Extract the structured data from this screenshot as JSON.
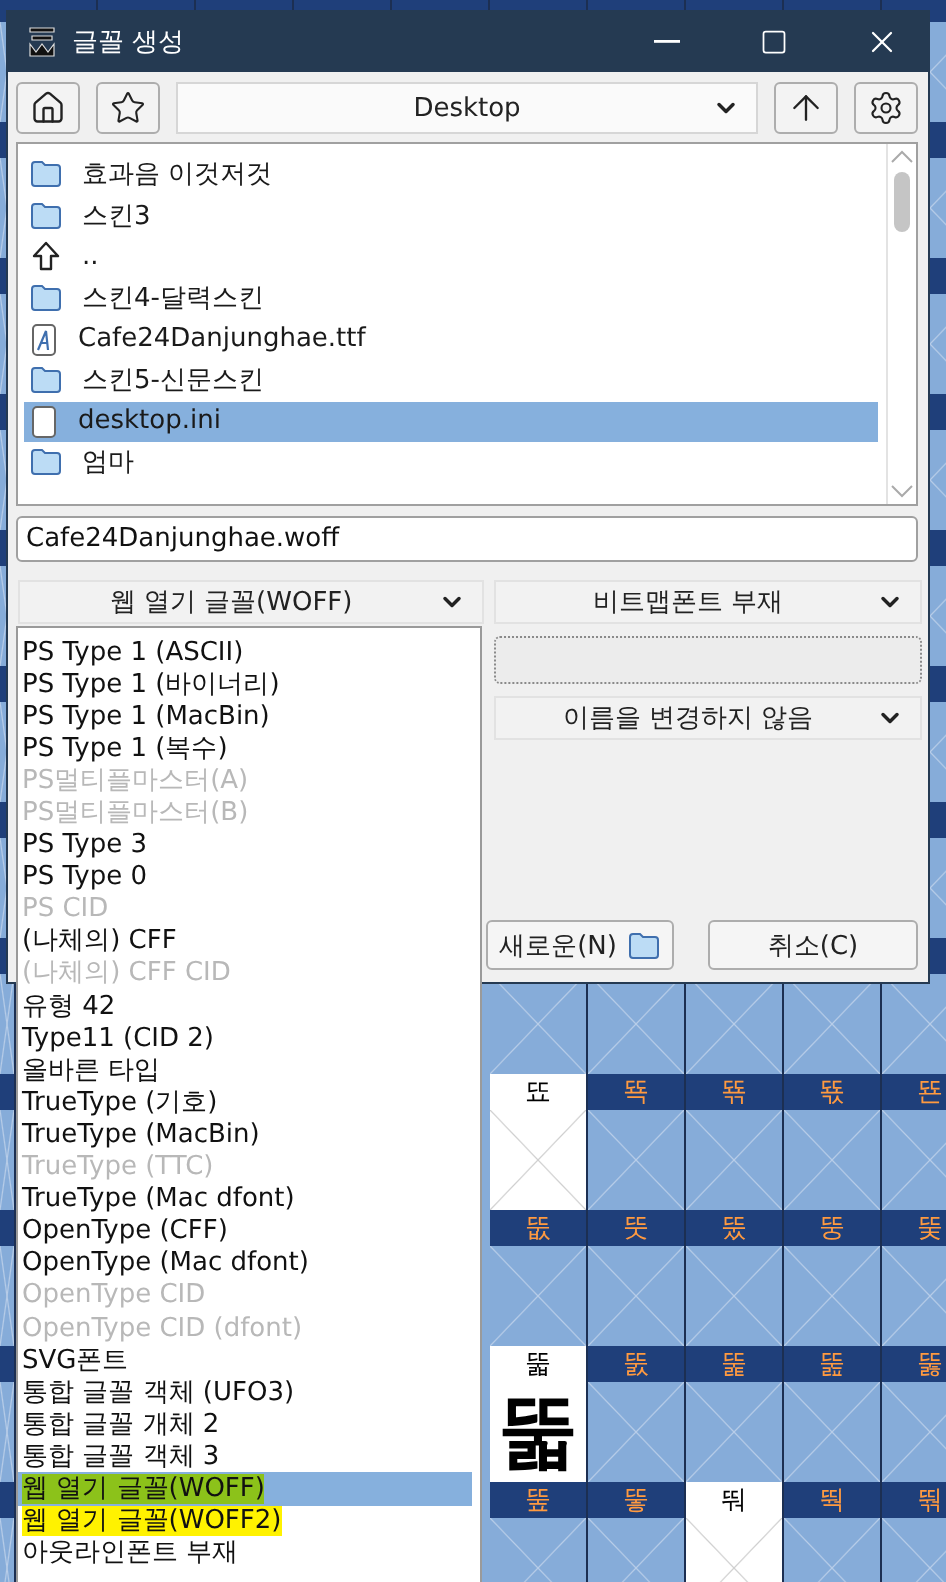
{
  "window": {
    "title": "글꼴 생성"
  },
  "toolbar": {
    "path": "Desktop"
  },
  "files": [
    {
      "name": "효과음 이것저것",
      "kind": "folder",
      "selected": false
    },
    {
      "name": "스킨3",
      "kind": "folder",
      "selected": false
    },
    {
      "name": "..",
      "kind": "parent",
      "selected": false
    },
    {
      "name": "스킨4-달력스킨",
      "kind": "folder",
      "selected": false
    },
    {
      "name": "Cafe24Danjunghae.ttf",
      "kind": "font",
      "selected": false
    },
    {
      "name": "스킨5-신문스킨",
      "kind": "folder",
      "selected": false
    },
    {
      "name": "desktop.ini",
      "kind": "file",
      "selected": true
    },
    {
      "name": "엄마",
      "kind": "folder",
      "selected": false
    }
  ],
  "filename": {
    "value": "Cafe24Danjunghae.woff"
  },
  "format_select": {
    "value": "웹 열기 글꼴(WOFF)"
  },
  "bitmap_select": {
    "value": "비트맵폰트 부재"
  },
  "rename_select": {
    "value": "이름을 변경하지 않음"
  },
  "buttons": [
    {
      "label": "새로운(N)",
      "kind": "new"
    },
    {
      "label": "취소(C)",
      "kind": "cancel"
    }
  ],
  "format_options": [
    {
      "label": "PS Type 1 (ASCII)",
      "disabled": false,
      "selected": false
    },
    {
      "label": "PS Type 1 (바이너리)",
      "disabled": false,
      "selected": false
    },
    {
      "label": "PS Type 1 (MacBin)",
      "disabled": false,
      "selected": false
    },
    {
      "label": "PS Type 1 (복수)",
      "disabled": false,
      "selected": false
    },
    {
      "label": "PS멀티플마스터(A)",
      "disabled": true,
      "selected": false
    },
    {
      "label": "PS멀티플마스터(B)",
      "disabled": true,
      "selected": false
    },
    {
      "label": "PS Type 3",
      "disabled": false,
      "selected": false
    },
    {
      "label": "PS Type 0",
      "disabled": false,
      "selected": false
    },
    {
      "label": "PS CID",
      "disabled": true,
      "selected": false
    },
    {
      "label": "(나체의) CFF",
      "disabled": false,
      "selected": false
    },
    {
      "label": "(나체의) CFF CID",
      "disabled": true,
      "selected": false
    },
    {
      "label": "유형 42",
      "disabled": false,
      "selected": false
    },
    {
      "label": "Type11 (CID 2)",
      "disabled": false,
      "selected": false
    },
    {
      "label": "올바른 타입",
      "disabled": false,
      "selected": false
    },
    {
      "label": "TrueType (기호)",
      "disabled": false,
      "selected": false
    },
    {
      "label": "TrueType (MacBin)",
      "disabled": false,
      "selected": false
    },
    {
      "label": "TrueType (TTC)",
      "disabled": true,
      "selected": false
    },
    {
      "label": "TrueType (Mac dfont)",
      "disabled": false,
      "selected": false
    },
    {
      "label": "OpenType (CFF)",
      "disabled": false,
      "selected": false
    },
    {
      "label": "OpenType (Mac dfont)",
      "disabled": false,
      "selected": false
    },
    {
      "label": "OpenType CID",
      "disabled": true,
      "selected": false
    },
    {
      "label": "OpenType CID (dfont)",
      "disabled": true,
      "selected": false
    },
    {
      "label": "SVG폰트",
      "disabled": false,
      "selected": false
    },
    {
      "label": "통합 글꼴 객체 (UFO3)",
      "disabled": false,
      "selected": false
    },
    {
      "label": "통합 글꼴 개체 2",
      "disabled": false,
      "selected": false
    },
    {
      "label": "통합 글꼴 객체 3",
      "disabled": false,
      "selected": false
    },
    {
      "label": "웹 열기 글꼴(WOFF)",
      "disabled": false,
      "selected": true,
      "color": "#8cc21a"
    },
    {
      "label": "웹 열기 글꼴(WOFF2)",
      "disabled": false,
      "selected": false,
      "color": "#fff200"
    },
    {
      "label": "아웃라인폰트 부재",
      "disabled": false,
      "selected": false
    }
  ],
  "glyph_grid": {
    "rows": [
      {
        "cells": [
          {
            "label": "뚀",
            "selected": true
          },
          {
            "label": "뚁",
            "selected": false
          },
          {
            "label": "뚂",
            "selected": false
          },
          {
            "label": "뚃",
            "selected": false
          },
          {
            "label": "뚄",
            "selected": false
          }
        ]
      },
      {
        "cells": [
          {
            "label": "뚮",
            "selected": false
          },
          {
            "label": "뚯",
            "selected": false
          },
          {
            "label": "뚰",
            "selected": false
          },
          {
            "label": "뚱",
            "selected": false
          },
          {
            "label": "뚲",
            "selected": false
          }
        ]
      },
      {
        "cells": [
          {
            "label": "뚧",
            "selected": true,
            "glyph": "뚧"
          },
          {
            "label": "뚨",
            "selected": false
          },
          {
            "label": "뚩",
            "selected": false
          },
          {
            "label": "뚪",
            "selected": false
          },
          {
            "label": "뚫",
            "selected": false
          }
        ]
      },
      {
        "cells": [
          {
            "label": "뚶",
            "selected": false
          },
          {
            "label": "뚷",
            "selected": false
          },
          {
            "label": "뚸",
            "selected": true
          },
          {
            "label": "뚹",
            "selected": false
          },
          {
            "label": "뚺",
            "selected": false
          }
        ]
      }
    ]
  }
}
